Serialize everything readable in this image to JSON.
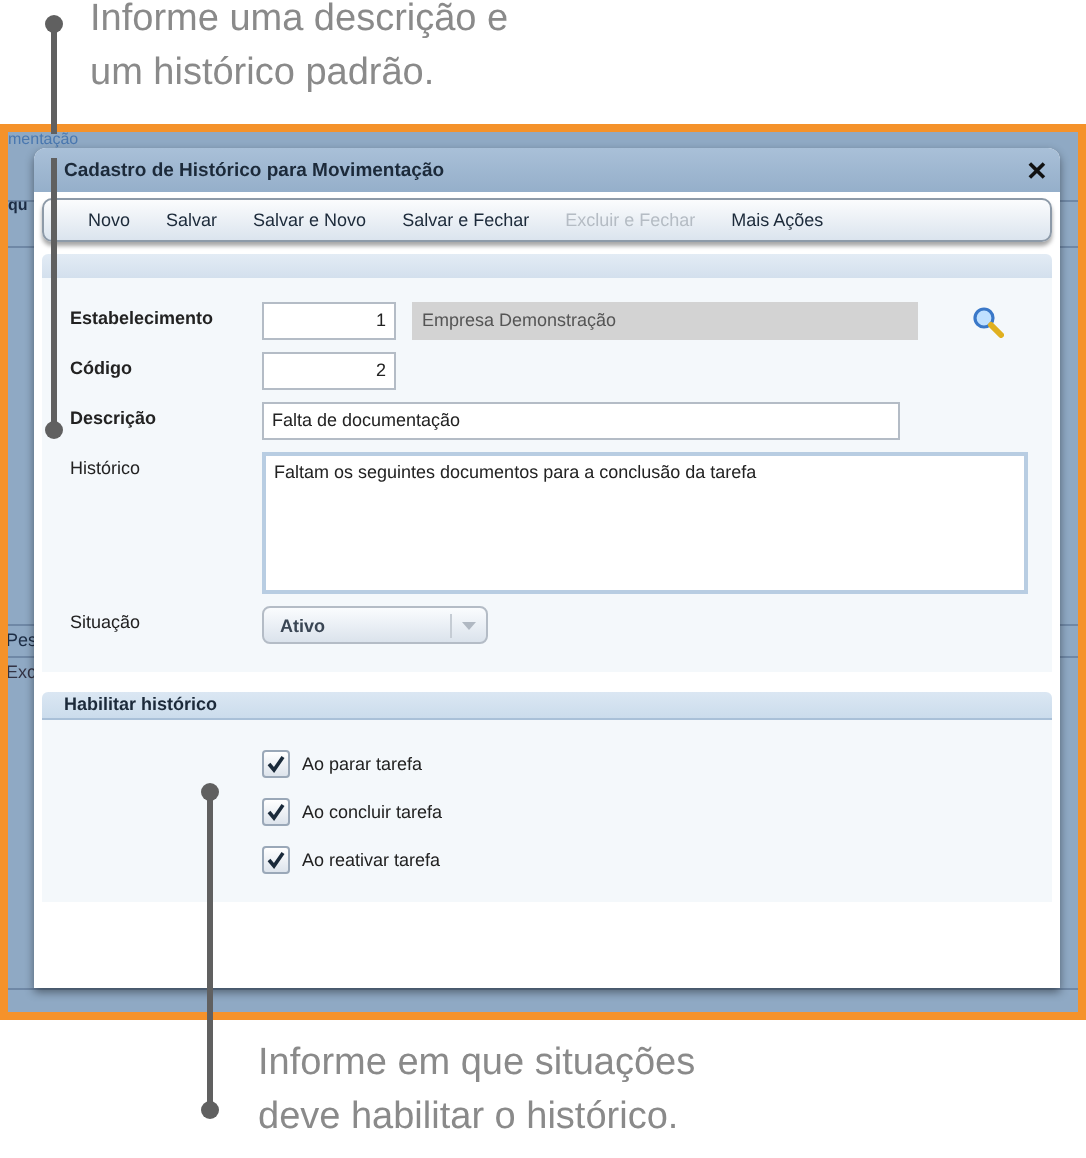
{
  "callouts": [
    {
      "lines": [
        "Informe uma descrição e",
        "um histórico padrão."
      ]
    },
    {
      "lines": [
        "Informe em que situações",
        "deve habilitar o histórico."
      ]
    }
  ],
  "background": {
    "fragments": [
      "mentação",
      "qu",
      "Pes",
      "Exc"
    ]
  },
  "dialog": {
    "title": "Cadastro de Histórico para Movimentação",
    "close": "✕",
    "toolbar": [
      {
        "label": "Novo",
        "disabled": false
      },
      {
        "label": "Salvar",
        "disabled": false
      },
      {
        "label": "Salvar e Novo",
        "disabled": false
      },
      {
        "label": "Salvar e Fechar",
        "disabled": false
      },
      {
        "label": "Excluir e Fechar",
        "disabled": true
      },
      {
        "label": "Mais Ações",
        "disabled": false
      }
    ],
    "fields": [
      {
        "kind": "lookup",
        "label": "Estabelecimento",
        "required": true,
        "value": "1",
        "description": "Empresa Demonstração"
      },
      {
        "kind": "number",
        "label": "Código",
        "required": true,
        "value": "2"
      },
      {
        "kind": "text",
        "label": "Descrição",
        "required": true,
        "value": "Falta de documentação"
      },
      {
        "kind": "memo",
        "label": "Histórico",
        "required": false,
        "value": "Faltam os seguintes documentos para a conclusão da tarefa"
      },
      {
        "kind": "select",
        "label": "Situação",
        "required": false,
        "value": "Ativo"
      }
    ],
    "section": {
      "title": "Habilitar histórico",
      "options": [
        {
          "label": "Ao parar tarefa",
          "checked": true
        },
        {
          "label": "Ao concluir tarefa",
          "checked": true
        },
        {
          "label": "Ao reativar tarefa",
          "checked": true
        }
      ]
    }
  }
}
